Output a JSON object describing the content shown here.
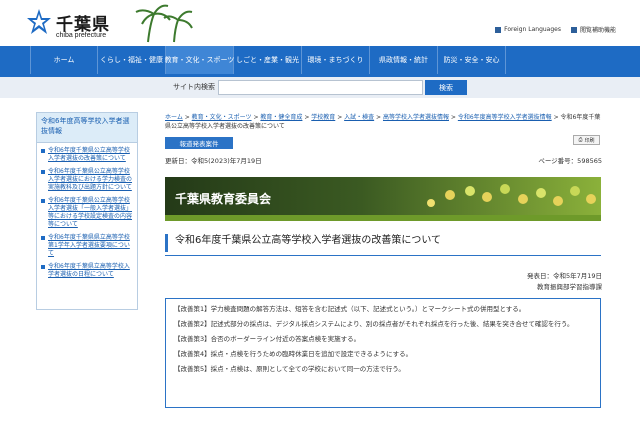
{
  "header": {
    "logo_name": "千葉県",
    "logo_sub": "chiba prefecture",
    "links": [
      "Foreign Languages",
      "閲覧補助機能"
    ]
  },
  "nav": {
    "items": [
      "ホーム",
      "くらし・福祉・健康",
      "教育・文化・スポーツ",
      "しごと・産業・観光",
      "環境・まちづくり",
      "県政情報・統計",
      "防災・安全・安心"
    ],
    "active_index": 2
  },
  "search": {
    "label": "サイト内検索",
    "placeholder": "",
    "button": "検索"
  },
  "sidebar": {
    "title": "令和6年度高等学校入学者選抜情報",
    "items": [
      "令和6年度千葉県公立高等学校入学者選抜の改善策について",
      "令和6年度千葉県公立高等学校入学者選抜における学力検査の実施教科及び出題方針について",
      "令和6年度千葉県公立高等学校入学者選抜「一般入学者選抜」等における学校設定検査の内容等について",
      "令和6年度千葉県県立高等学校第1学年入学者選抜要項について",
      "令和6年度千葉県立高等学校入学者選抜の日程について"
    ]
  },
  "breadcrumb": {
    "links": [
      "ホーム",
      "教育・文化・スポーツ",
      "教育・健全育成",
      "学校教育",
      "入試・検査",
      "高等学校入学者選抜情報",
      "令和6年度高等学校入学者選抜情報"
    ],
    "current": "令和6年度千葉県公立高等学校入学者選抜の改善策について",
    "sep": " > "
  },
  "print_label": "印刷",
  "press_label": "報道発表案件",
  "updated": "更新日：令和5(2023)年7月19日",
  "page_number": "ページ番号：598565",
  "banner_title": "千葉県教育委員会",
  "page_title": "令和6年度千葉県公立高等学校入学者選抜の改善策について",
  "issue": {
    "date": "発表日：令和5年7月19日",
    "dept": "教育振興部学習指導課"
  },
  "measures": [
    "【改善策1】学力検査問題の解答方法は、短答を含む記述式（以下、記述式という。）とマークシート式の併用型とする。",
    "【改善策2】記述式部分の採点は、デジタル採点システムにより、別の採点者がそれぞれ採点を行った後、結果を突き合せて確認を行う。",
    "【改善策3】合否のボーダーライン付近の答案点検を実施する。",
    "【改善策4】採点・点検を行うための臨時休業日を追加で設定できるようにする。",
    "【改善策5】採点・点検は、原則として全ての学校において同一の方法で行う。"
  ],
  "colors": {
    "primary": "#1e6bc4",
    "nav_active": "#3f86d6",
    "link": "#1a5fb0",
    "sidebar_title_bg": "#dcecf8",
    "banner_dark": "#2f4a1f",
    "banner_green": "#6e9a2a"
  }
}
